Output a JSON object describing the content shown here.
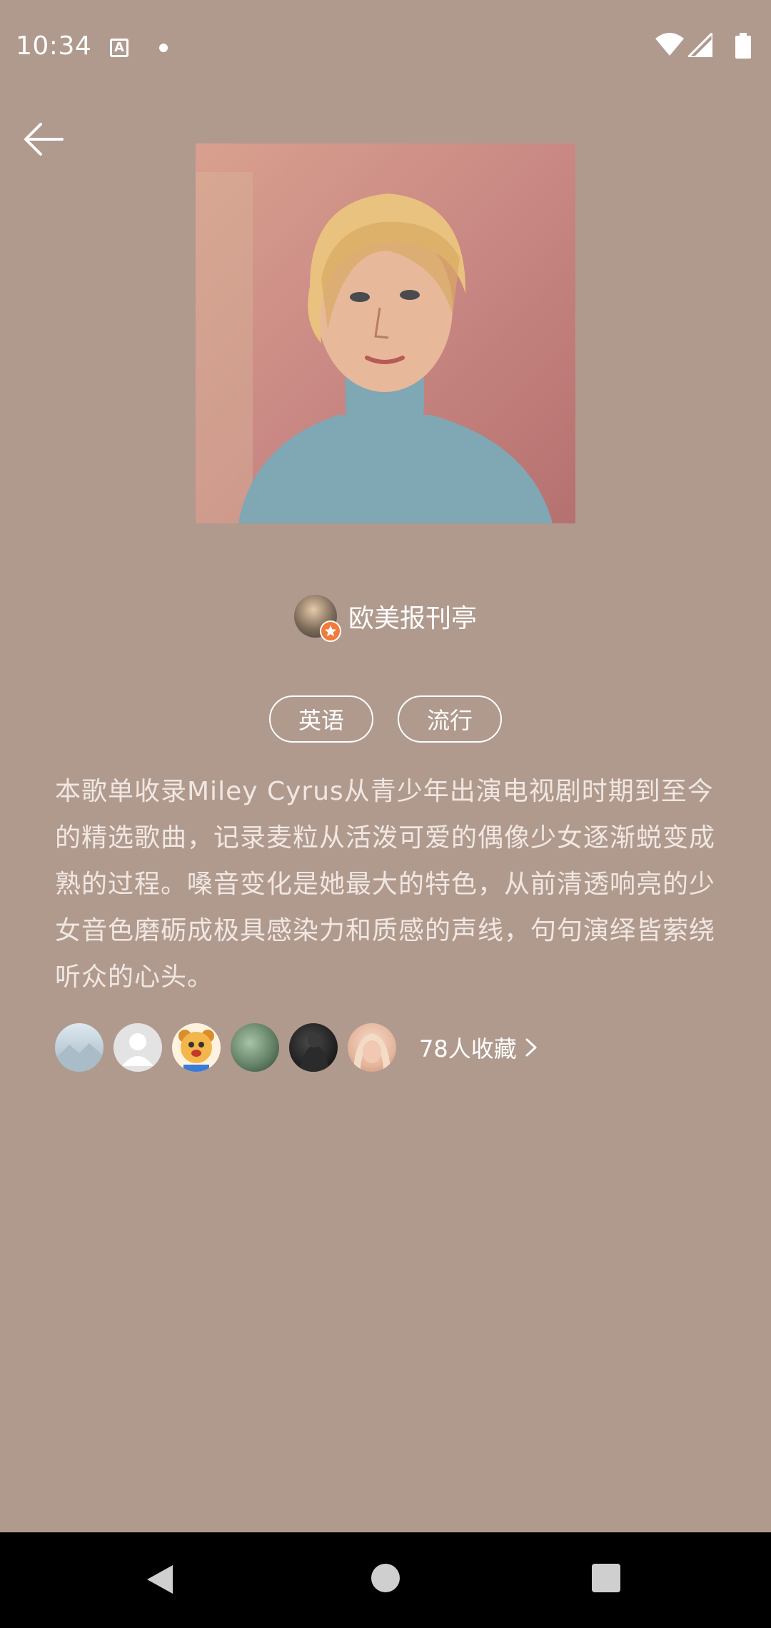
{
  "status_bar": {
    "time": "10:34",
    "notification_icon": "a-icon",
    "dot_icon": "dot-icon",
    "wifi_icon": "wifi-icon",
    "signal_icon": "signal-icon",
    "battery_icon": "battery-icon"
  },
  "header": {
    "back_icon": "arrow-left-icon"
  },
  "playlist": {
    "creator_name": "欧美报刊亭",
    "tags": [
      "英语",
      "流行"
    ],
    "description": "本歌单收录Miley Cyrus从青少年出演电视剧时期到至今的精选歌曲，记录麦粒从活泼可爱的偶像少女逐渐蜕变成熟的过程。嗓音变化是她最大的特色，从前清透响亮的少女音色磨砺成极具感染力和质感的声线，句句演绎皆萦绕听众的心头。",
    "collect_label": "78人收藏"
  },
  "nav": {
    "back_icon": "triangle-back-icon",
    "home_icon": "circle-home-icon",
    "recents_icon": "square-recents-icon"
  },
  "colors": {
    "background": "#b09a8e",
    "text": "#ffffff",
    "badge": "#f07b3a"
  }
}
